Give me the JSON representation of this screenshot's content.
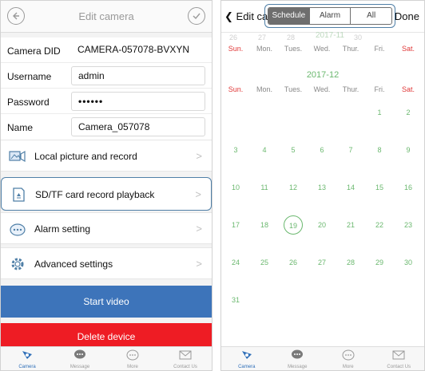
{
  "left": {
    "title": "Edit camera",
    "fields": [
      {
        "label": "Camera DID",
        "value": "CAMERA-057078-BVXYN"
      },
      {
        "label": "Username",
        "value": "admin"
      },
      {
        "label": "Password",
        "value": "••••••"
      },
      {
        "label": "Name",
        "value": "Camera_057078"
      }
    ],
    "menu": [
      {
        "label": "Local picture and record",
        "icon": "picture-record-icon"
      },
      {
        "label": "SD/TF card record playback",
        "icon": "sd-card-icon"
      },
      {
        "label": "Alarm setting",
        "icon": "alarm-icon"
      },
      {
        "label": "Advanced settings",
        "icon": "gear-icon"
      }
    ],
    "chevron": ">",
    "start_video": "Start video",
    "delete_device": "Delete device",
    "colors": {
      "start_video_bg": "#3d74ba",
      "delete_bg": "#ee1c24",
      "highlight": "#4f7fa7"
    }
  },
  "tabs": [
    {
      "label": "Camera",
      "icon": "camera-icon",
      "active": true
    },
    {
      "label": "Message",
      "icon": "message-icon",
      "active": false
    },
    {
      "label": "More",
      "icon": "more-icon",
      "active": false
    },
    {
      "label": "Contact Us",
      "icon": "contact-icon",
      "active": false
    }
  ],
  "right": {
    "back_label": "Edit camera",
    "segments": [
      "Schedule",
      "Alarm",
      "All"
    ],
    "active_segment": "Schedule",
    "done_label": "Done",
    "prev_month_title": "2017-11",
    "prev_month_days": [
      "26",
      "27",
      "28",
      "29",
      "30"
    ],
    "month_title": "2017-12",
    "weekdays": [
      "Sun.",
      "Mon.",
      "Tues.",
      "Wed.",
      "Thur.",
      "Fri.",
      "Sat."
    ],
    "days": [
      "1",
      "2",
      "3",
      "4",
      "5",
      "6",
      "7",
      "8",
      "9",
      "10",
      "11",
      "12",
      "13",
      "14",
      "15",
      "16",
      "17",
      "18",
      "19",
      "20",
      "21",
      "22",
      "23",
      "24",
      "25",
      "26",
      "27",
      "28",
      "29",
      "30",
      "31"
    ],
    "first_weekday": 5,
    "today": "19",
    "colors": {
      "day": "#6bb86f",
      "weekend": "#e03a3a"
    }
  }
}
